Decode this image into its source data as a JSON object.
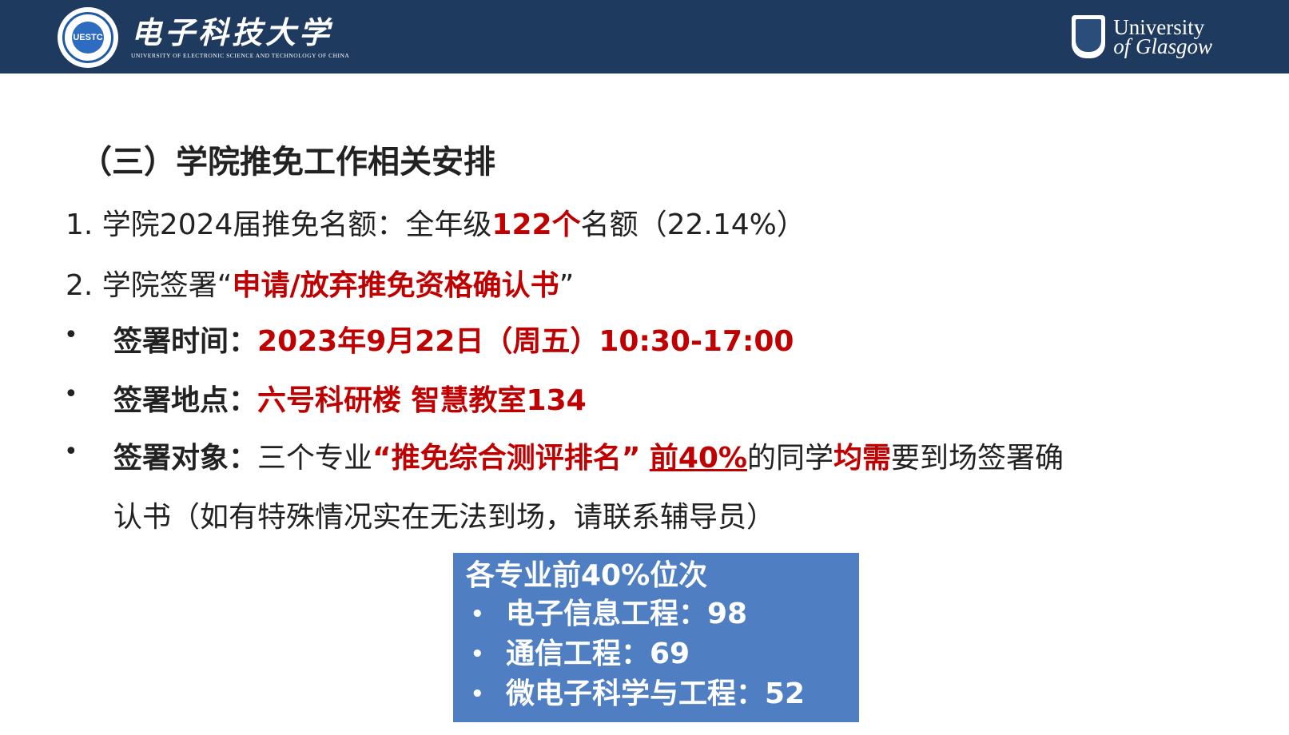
{
  "header": {
    "left_logo_cn": "电子科技大学",
    "left_logo_en": "UNIVERSITY OF ELECTRONIC SCIENCE AND TECHNOLOGY OF CHINA",
    "left_seal_text": "UESTC",
    "right_logo_line1": "University",
    "right_logo_line2": "of Glasgow",
    "bg_color": "#1f3a5f"
  },
  "slide": {
    "title": "（三）学院推免工作相关安排",
    "item1": {
      "prefix": "1. 学院2024届推免名额：全年级",
      "highlight": "122个",
      "suffix": "名额（22.14%）"
    },
    "item2": {
      "prefix": "2. 学院签署",
      "open_quote": "“",
      "highlight": "申请/放弃推免资格确认书",
      "close_quote": "”"
    },
    "bullets": [
      {
        "symbol": "•",
        "label": "签署时间：",
        "value": "2023年9月22日（周五）10:30-17:00"
      },
      {
        "symbol": "•",
        "label": "签署地点：",
        "value": "六号科研楼 智慧教室134"
      },
      {
        "symbol": "•",
        "label": "签署对象：",
        "part1": "三个专业",
        "part2": "“推免综合测评排名”",
        "part3": "前40%",
        "part4": "的同学",
        "part5": "均需",
        "part6": "要到场签署确",
        "line2": "认书（如有特殊情况实在无法到场，请联系辅导员）"
      }
    ],
    "accent_color": "#c00000"
  },
  "info_box": {
    "title": "各专业前40%位次",
    "items": [
      {
        "symbol": "•",
        "text": "电子信息工程：98"
      },
      {
        "symbol": "•",
        "text": "通信工程：69"
      },
      {
        "symbol": "•",
        "text": "微电子科学与工程：52"
      }
    ],
    "bg_color": "#4f7fc2"
  }
}
